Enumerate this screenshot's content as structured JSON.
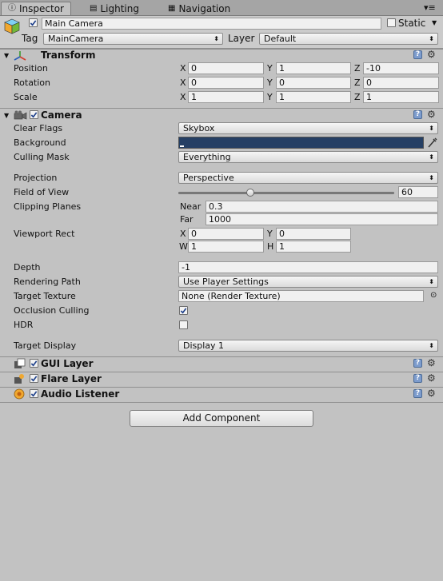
{
  "tabs": [
    {
      "label": "Inspector",
      "icon": "info-icon"
    },
    {
      "label": "Lighting",
      "icon": "lighting-icon"
    },
    {
      "label": "Navigation",
      "icon": "navigation-icon"
    }
  ],
  "header": {
    "name": "Main Camera",
    "static_label": "Static",
    "tag_label": "Tag",
    "tag_value": "MainCamera",
    "layer_label": "Layer",
    "layer_value": "Default"
  },
  "transform": {
    "title": "Transform",
    "position_label": "Position",
    "rotation_label": "Rotation",
    "scale_label": "Scale",
    "position": {
      "x": "0",
      "y": "1",
      "z": "-10"
    },
    "rotation": {
      "x": "0",
      "y": "0",
      "z": "0"
    },
    "scale": {
      "x": "1",
      "y": "1",
      "z": "1"
    },
    "axis_x": "X",
    "axis_y": "Y",
    "axis_z": "Z"
  },
  "camera": {
    "title": "Camera",
    "clear_flags_label": "Clear Flags",
    "clear_flags_value": "Skybox",
    "background_label": "Background",
    "background_color": "#253f64",
    "culling_mask_label": "Culling Mask",
    "culling_mask_value": "Everything",
    "projection_label": "Projection",
    "projection_value": "Perspective",
    "fov_label": "Field of View",
    "fov_value": "60",
    "fov_fraction": 0.333,
    "clipping_label": "Clipping Planes",
    "near_label": "Near",
    "near_value": "0.3",
    "far_label": "Far",
    "far_value": "1000",
    "viewport_label": "Viewport Rect",
    "vp_x_label": "X",
    "vp_x": "0",
    "vp_y_label": "Y",
    "vp_y": "0",
    "vp_w_label": "W",
    "vp_w": "1",
    "vp_h_label": "H",
    "vp_h": "1",
    "depth_label": "Depth",
    "depth_value": "-1",
    "rendering_path_label": "Rendering Path",
    "rendering_path_value": "Use Player Settings",
    "target_texture_label": "Target Texture",
    "target_texture_value": "None (Render Texture)",
    "occlusion_label": "Occlusion Culling",
    "occlusion_checked": true,
    "hdr_label": "HDR",
    "hdr_checked": false,
    "target_display_label": "Target Display",
    "target_display_value": "Display 1"
  },
  "components": [
    {
      "title": "GUI Layer",
      "icon": "gui-layer-icon"
    },
    {
      "title": "Flare Layer",
      "icon": "flare-layer-icon"
    },
    {
      "title": "Audio Listener",
      "icon": "audio-listener-icon"
    }
  ],
  "add_component_label": "Add Component",
  "colors": {
    "accent_blue": "#2a5cb8",
    "help_blue": "#7d9ccd"
  }
}
